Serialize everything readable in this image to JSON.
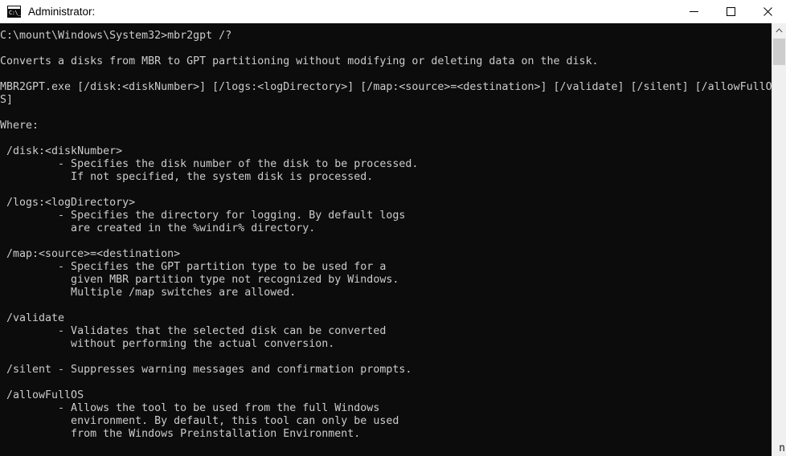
{
  "window": {
    "title": "Administrator:",
    "icon": "command-prompt-icon",
    "icon_prompt_text": "C:\\_",
    "background_color": "#ffffff",
    "console_background_color": "#0c0c0c",
    "console_text_color": "#cccccc"
  },
  "window_controls": {
    "minimize_label": "Minimize",
    "maximize_label": "Maximize",
    "close_label": "Close"
  },
  "console": {
    "prompt_line": "C:\\mount\\Windows\\System32>mbr2gpt /?",
    "text": "C:\\mount\\Windows\\System32>mbr2gpt /?\n\nConverts a disks from MBR to GPT partitioning without modifying or deleting data on the disk.\n\nMBR2GPT.exe [/disk:<diskNumber>] [/logs:<logDirectory>] [/map:<source>=<destination>] [/validate] [/silent] [/allowFullO\nS]\n\nWhere:\n\n /disk:<diskNumber>\n         - Specifies the disk number of the disk to be processed.\n           If not specified, the system disk is processed.\n\n /logs:<logDirectory>\n         - Specifies the directory for logging. By default logs\n           are created in the %windir% directory.\n\n /map:<source>=<destination>\n         - Specifies the GPT partition type to be used for a\n           given MBR partition type not recognized by Windows.\n           Multiple /map switches are allowed.\n\n /validate\n         - Validates that the selected disk can be converted\n           without performing the actual conversion.\n\n /silent - Suppresses warning messages and confirmation prompts.\n\n /allowFullOS\n         - Allows the tool to be used from the full Windows\n           environment. By default, this tool can only be used\n           from the Windows Preinstallation Environment.",
    "lines": [
      "C:\\mount\\Windows\\System32>mbr2gpt /?",
      "",
      "Converts a disks from MBR to GPT partitioning without modifying or deleting data on the disk.",
      "",
      "MBR2GPT.exe [/disk:<diskNumber>] [/logs:<logDirectory>] [/map:<source>=<destination>] [/validate] [/silent] [/allowFullO",
      "S]",
      "",
      "Where:",
      "",
      " /disk:<diskNumber>",
      "         - Specifies the disk number of the disk to be processed.",
      "           If not specified, the system disk is processed.",
      "",
      " /logs:<logDirectory>",
      "         - Specifies the directory for logging. By default logs",
      "           are created in the %windir% directory.",
      "",
      " /map:<source>=<destination>",
      "         - Specifies the GPT partition type to be used for a",
      "           given MBR partition type not recognized by Windows.",
      "           Multiple /map switches are allowed.",
      "",
      " /validate",
      "         - Validates that the selected disk can be converted",
      "           without performing the actual conversion.",
      "",
      " /silent - Suppresses warning messages and confirmation prompts.",
      "",
      " /allowFullOS",
      "         - Allows the tool to be used from the full Windows",
      "           environment. By default, this tool can only be used",
      "           from the Windows Preinstallation Environment."
    ]
  },
  "scrollbar": {
    "up_arrow": "chevron-up",
    "thumb_position_percent": 3
  },
  "artifacts": {
    "bottom_right_glyph": "n"
  }
}
